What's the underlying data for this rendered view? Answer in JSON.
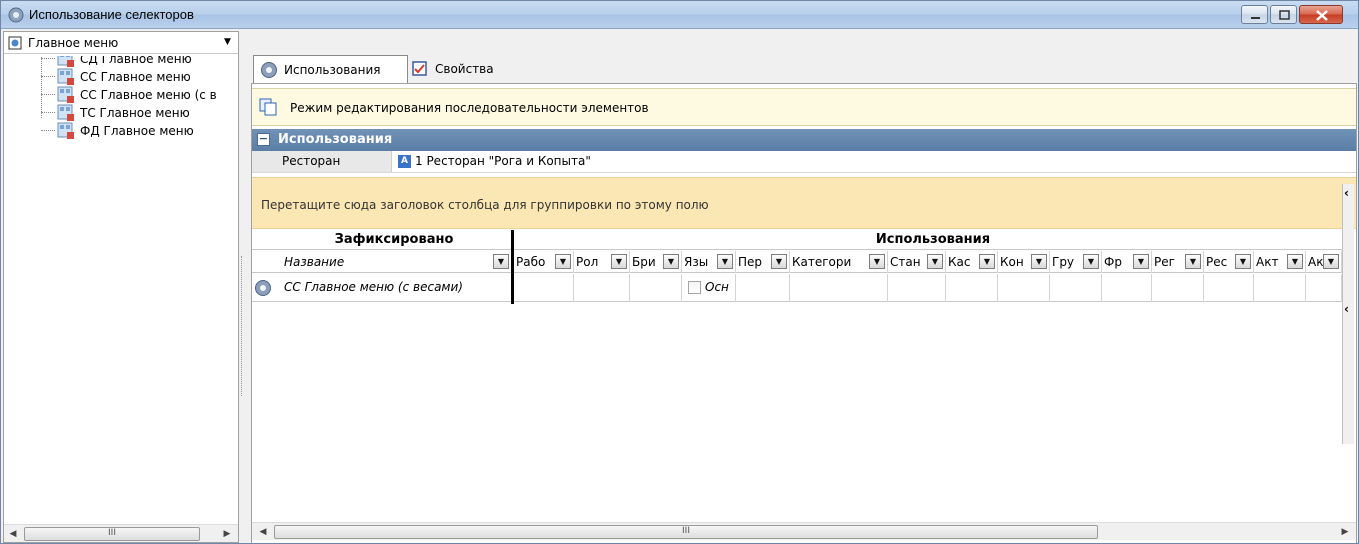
{
  "window": {
    "title": "Использование селекторов",
    "buttons": {
      "minimize": "minimize-icon",
      "maximize": "maximize-icon",
      "close": "close-icon"
    }
  },
  "left_panel": {
    "selector": {
      "value": "Главное меню"
    },
    "tree": [
      {
        "label": "СД Главное меню"
      },
      {
        "label": "СС Главное меню"
      },
      {
        "label": "СС Главное меню (с в"
      },
      {
        "label": "ТС Главное меню"
      },
      {
        "label": "ФД Главное меню"
      }
    ],
    "scroll_thumb": "III"
  },
  "tabs": [
    {
      "label": "Использования",
      "active": true
    },
    {
      "label": "Свойства",
      "active": false
    }
  ],
  "edit_mode": {
    "label": "Режим редактирования последовательности элементов"
  },
  "section": {
    "title": "Использования",
    "collapse_symbol": "−",
    "property": {
      "label": "Ресторан",
      "icon_letter": "A",
      "value": "1 Ресторан \"Рога и Копыта\""
    }
  },
  "group_panel": {
    "hint": "Перетащите сюда заголовок столбца для группировки по этому полю"
  },
  "grid": {
    "bands": {
      "fixed": "Зафиксировано",
      "usage": "Использования"
    },
    "name_column": "Название",
    "columns": [
      {
        "label": "Рабо"
      },
      {
        "label": "Рол"
      },
      {
        "label": "Бри"
      },
      {
        "label": "Язы"
      },
      {
        "label": "Пер"
      },
      {
        "label": "Категори"
      },
      {
        "label": "Стан"
      },
      {
        "label": "Кас"
      },
      {
        "label": "Кон"
      },
      {
        "label": "Гру"
      },
      {
        "label": "Фр"
      },
      {
        "label": "Рег"
      },
      {
        "label": "Рес"
      },
      {
        "label": "Акт"
      },
      {
        "label": "Акт"
      }
    ],
    "rows": [
      {
        "name": "СС Главное меню (с весами)",
        "checkbox_text": "Осн"
      }
    ]
  },
  "main_scroll_thumb": "III",
  "colors": {
    "section_header": "#5b7ea7",
    "edit_bar": "#fdfae1",
    "group_bar": "#fbe7b4"
  }
}
